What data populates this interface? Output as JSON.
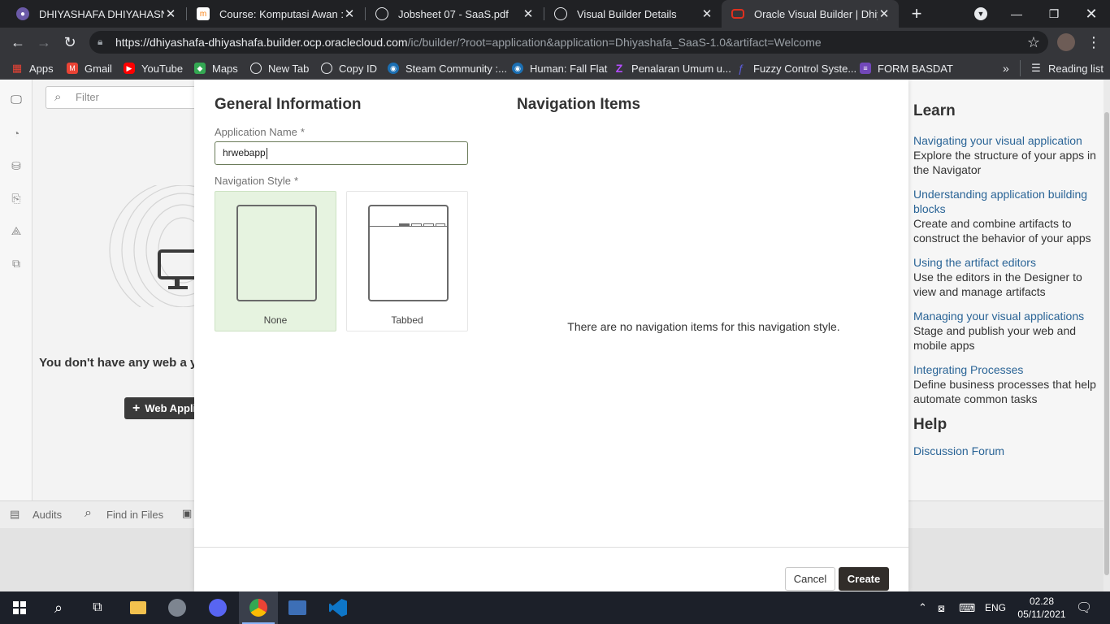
{
  "browser": {
    "tabs": [
      {
        "title": "DHIYASHAFA DHIYAHASNA H",
        "icon": "university-logo-icon",
        "color": "#6b5aa8"
      },
      {
        "title": "Course: Komputasi Awan : Di",
        "icon": "moodle-icon",
        "color": "#ffffff"
      },
      {
        "title": "Jobsheet 07 - SaaS.pdf",
        "icon": "globe-icon",
        "color": "#e8eaed"
      },
      {
        "title": "Visual Builder Details",
        "icon": "globe-icon",
        "color": "#e8eaed"
      },
      {
        "title": "Oracle Visual Builder | Dhiyas",
        "icon": "oracle-icon",
        "color": "#e0301e"
      }
    ],
    "url_host": "https://dhiyashafa-dhiyashafa.builder.ocp.oraclecloud.com",
    "url_path": "/ic/builder/?root=application&application=Dhiyashafa_SaaS-1.0&artifact=Welcome",
    "bookmarks": [
      {
        "label": "Apps",
        "icon": "apps-grid-icon",
        "color": "#e8eaed"
      },
      {
        "label": "Gmail",
        "icon": "gmail-icon",
        "color": "#ea4335"
      },
      {
        "label": "YouTube",
        "icon": "youtube-icon",
        "color": "#ff0000"
      },
      {
        "label": "Maps",
        "icon": "maps-icon",
        "color": "#34a853"
      },
      {
        "label": "New Tab",
        "icon": "globe-icon",
        "color": "#e8eaed"
      },
      {
        "label": "Copy ID",
        "icon": "globe-icon",
        "color": "#e8eaed"
      },
      {
        "label": "Steam Community :...",
        "icon": "steam-icon",
        "color": "#1b6fb3"
      },
      {
        "label": "Human: Fall Flat",
        "icon": "steam-icon",
        "color": "#1b6fb3"
      },
      {
        "label": "Penalaran Umum u...",
        "icon": "zenius-icon",
        "color": "#9b30ff"
      },
      {
        "label": "Fuzzy Control Syste...",
        "icon": "fuzzy-icon",
        "color": "#5b5bd6"
      },
      {
        "label": "FORM BASDAT",
        "icon": "forms-icon",
        "color": "#7248b9"
      }
    ],
    "reading_list": "Reading list"
  },
  "background": {
    "filter_placeholder": "Filter",
    "empty_message": "You don't have any web a yet.",
    "web_app_button": "Web Appli",
    "bottom": {
      "audits": "Audits",
      "find_in_files": "Find in Files"
    }
  },
  "dialog": {
    "general_heading": "General Information",
    "app_name_label": "Application Name",
    "required_mark": "*",
    "app_name_value": "hrwebapp",
    "nav_style_label": "Navigation Style",
    "styles": [
      {
        "label": "None",
        "selected": true
      },
      {
        "label": "Tabbed",
        "selected": false
      }
    ],
    "nav_items_heading": "Navigation Items",
    "nav_items_empty": "There are no navigation items for this navigation style.",
    "cancel": "Cancel",
    "create": "Create"
  },
  "learn": {
    "heading": "Learn",
    "items": [
      {
        "link": "Navigating your visual application",
        "desc": "Explore the structure of your apps in the Navigator"
      },
      {
        "link": "Understanding application building blocks",
        "desc": "Create and combine artifacts to construct the behavior of your apps"
      },
      {
        "link": "Using the artifact editors",
        "desc": "Use the editors in the Designer to view and manage artifacts"
      },
      {
        "link": "Managing your visual applications",
        "desc": "Stage and publish your web and mobile apps"
      },
      {
        "link": "Integrating Processes",
        "desc": "Define business processes that help automate common tasks"
      }
    ],
    "help_heading": "Help",
    "help_link": "Discussion Forum"
  },
  "taskbar": {
    "language": "ENG",
    "time": "02.28",
    "date": "05/11/2021"
  }
}
